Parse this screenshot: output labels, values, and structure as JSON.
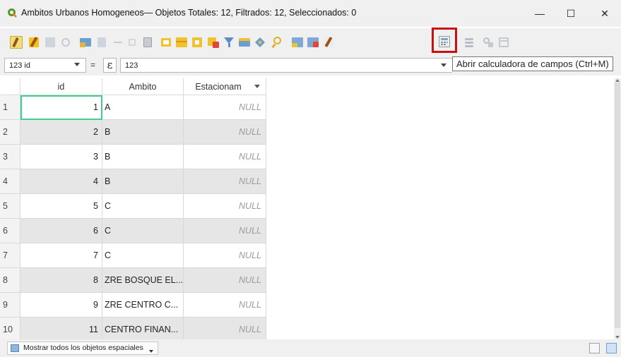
{
  "window": {
    "title": "Ambitos Urbanos Homogeneos— Objetos Totales: 12, Filtrados: 12, Seleccionados: 0",
    "minimize": "—",
    "maximize": "☐",
    "close": "✕"
  },
  "toolbar": {
    "icons": [
      "edit-toggle-icon",
      "multi-edit-icon",
      "save-edits-icon",
      "reload-icon",
      "add-feature-icon",
      "delete-feature-icon",
      "cut-icon",
      "copy-icon",
      "paste-icon",
      "expression-select-icon",
      "select-all-icon",
      "invert-selection-icon",
      "deselect-all-icon",
      "filter-icon",
      "move-selection-top-icon",
      "pan-to-selection-icon",
      "zoom-to-selection-icon",
      "copy-rows-icon",
      "paste-rows-icon",
      "delete-field-icon",
      "field-calculator-icon",
      "conditional-format-icon",
      "actions-icon",
      "dock-icon"
    ],
    "tooltip": "Abrir calculadora de campos (Ctrl+M)"
  },
  "expression_bar": {
    "field_type": "123",
    "field": "id",
    "operator": "=",
    "epsilon": "ε",
    "value": "123"
  },
  "table": {
    "columns": [
      "id",
      "Ambito",
      "Estacionam"
    ],
    "rows": [
      {
        "n": "1",
        "id": "1",
        "ambito": "A",
        "est": "NULL"
      },
      {
        "n": "2",
        "id": "2",
        "ambito": "B",
        "est": "NULL"
      },
      {
        "n": "3",
        "id": "3",
        "ambito": "B",
        "est": "NULL"
      },
      {
        "n": "4",
        "id": "4",
        "ambito": "B",
        "est": "NULL"
      },
      {
        "n": "5",
        "id": "5",
        "ambito": "C",
        "est": "NULL"
      },
      {
        "n": "6",
        "id": "6",
        "ambito": "C",
        "est": "NULL"
      },
      {
        "n": "7",
        "id": "7",
        "ambito": "C",
        "est": "NULL"
      },
      {
        "n": "8",
        "id": "8",
        "ambito": "ZRE BOSQUE EL...",
        "est": "NULL"
      },
      {
        "n": "9",
        "id": "9",
        "ambito": "ZRE CENTRO C...",
        "est": "NULL"
      },
      {
        "n": "10",
        "id": "11",
        "ambito": "CENTRO FINAN...",
        "est": "NULL"
      }
    ]
  },
  "bottom": {
    "show_features": "Mostrar todos los objetos espaciales"
  },
  "colors": {
    "highlight": "#c81010",
    "selection": "#3fcf8e",
    "alt_row": "#e6e6e6",
    "null_text": "#9b9b9b"
  }
}
